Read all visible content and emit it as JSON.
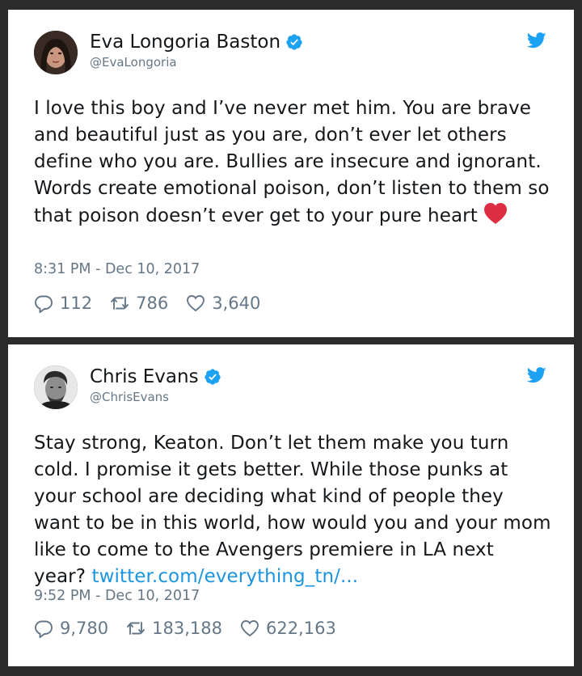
{
  "colors": {
    "text": "#14171a",
    "muted": "#657786",
    "link": "#1b95e0",
    "verified": "#1da1f2",
    "heart": "#e0245e"
  },
  "tweets": [
    {
      "name": "Eva Longoria Baston",
      "handle": "@EvaLongoria",
      "text": "I love this boy and I’ve never met him. You are brave and beautiful just as you are, don’t ever let others define who you are. Bullies are insecure and ignorant. Words create emotional poison, don’t listen to them so that poison doesn’t ever get to your pure heart",
      "emoji": "red-heart",
      "link": "",
      "time": "8:31 PM - Dec 10, 2017",
      "replies": "112",
      "retweets": "786",
      "likes": "3,640"
    },
    {
      "name": "Chris Evans",
      "handle": "@ChrisEvans",
      "text": "Stay strong, Keaton. Don’t let them make you turn cold. I promise it gets better. While those punks at your school are deciding what kind of people they want to be in this world, how would you and your mom like to come to the Avengers premiere in LA next year?",
      "link": "twitter.com/everything_tn/...",
      "time": "9:52 PM - Dec 10, 2017",
      "replies": "9,780",
      "retweets": "183,188",
      "likes": "622,163"
    }
  ]
}
